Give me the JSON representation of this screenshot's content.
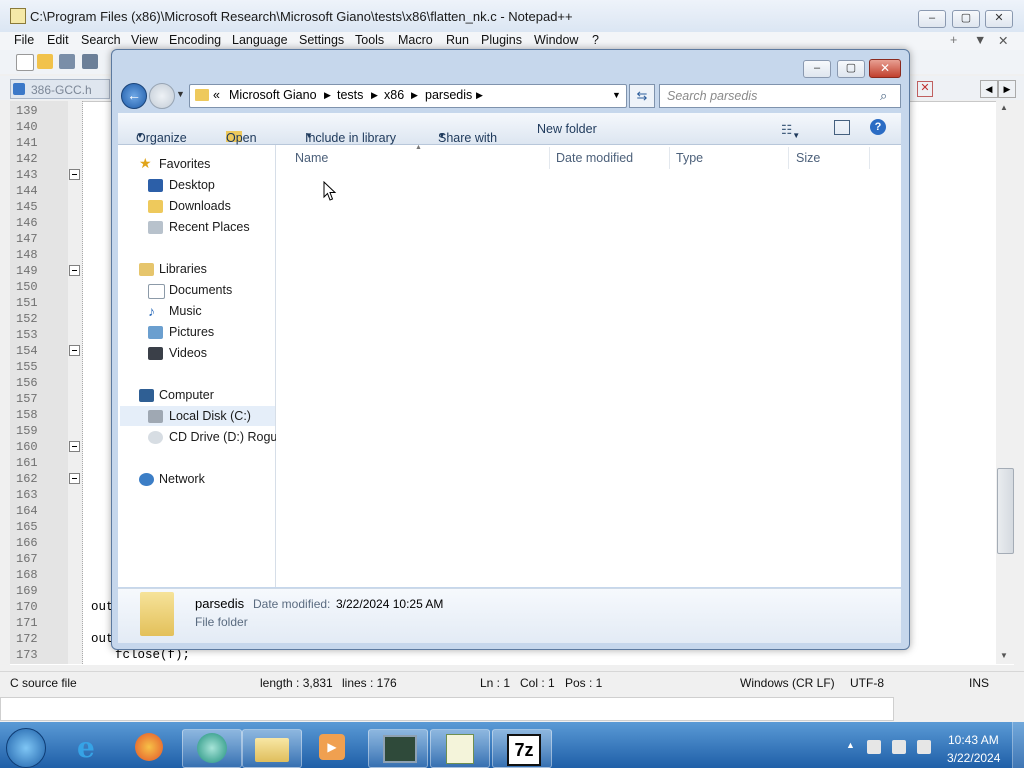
{
  "notepad": {
    "title": "C:\\Program Files (x86)\\Microsoft Research\\Microsoft Giano\\tests\\x86\\flatten_nk.c - Notepad++",
    "menu": [
      "File",
      "Edit",
      "Search",
      "View",
      "Encoding",
      "Language",
      "Settings",
      "Tools",
      "Macro",
      "Run",
      "Plugins",
      "Window",
      "?"
    ],
    "menu_right": [
      "+",
      "▼",
      "✕"
    ],
    "tab_label": "386-GCC.h",
    "line_numbers": [
      "139",
      "140",
      "141",
      "142",
      "143",
      "144",
      "145",
      "146",
      "147",
      "148",
      "149",
      "150",
      "151",
      "152",
      "153",
      "154",
      "155",
      "156",
      "157",
      "158",
      "159",
      "160",
      "161",
      "162",
      "163",
      "164",
      "165",
      "166",
      "167",
      "168",
      "169",
      "170",
      "171",
      "172",
      "173"
    ],
    "code_snippets": {
      "l170": "out",
      "l172": "out",
      "l173": "fclose(f);"
    },
    "status": {
      "filetype": "C source file",
      "length": "length : 3,831",
      "lines": "lines : 176",
      "ln": "Ln : 1",
      "col": "Col : 1",
      "pos": "Pos : 1",
      "eol": "Windows (CR LF)",
      "encoding": "UTF-8",
      "mode": "INS"
    }
  },
  "explorer": {
    "breadcrumb": [
      "«",
      "Microsoft Giano",
      "tests",
      "x86",
      "parsedis"
    ],
    "search_placeholder": "Search parsedis",
    "commands": [
      "Organize",
      "Open",
      "Include in library",
      "Share with",
      "New folder"
    ],
    "nav": {
      "favorites_header": "Favorites",
      "favorites": [
        "Desktop",
        "Downloads",
        "Recent Places"
      ],
      "libraries_header": "Libraries",
      "libraries": [
        "Documents",
        "Music",
        "Pictures",
        "Videos"
      ],
      "computer_header": "Computer",
      "computer": [
        "Local Disk (C:)",
        "CD Drive (D:) Rogue"
      ],
      "network_header": "Network"
    },
    "columns": [
      "Name",
      "Date modified",
      "Type",
      "Size"
    ],
    "details": {
      "name": "parsedis",
      "date_label": "Date modified:",
      "date_value": "3/22/2024 10:25 AM",
      "type": "File folder"
    }
  },
  "taskbar": {
    "time": "10:43 AM",
    "date": "3/22/2024",
    "apps": [
      "start-orb",
      "internet-explorer-icon",
      "firefox-icon",
      "app-icon",
      "windows-explorer-icon",
      "media-player-icon",
      "task-manager-icon",
      "notepad-plus-plus-icon",
      "7zip-icon"
    ]
  }
}
